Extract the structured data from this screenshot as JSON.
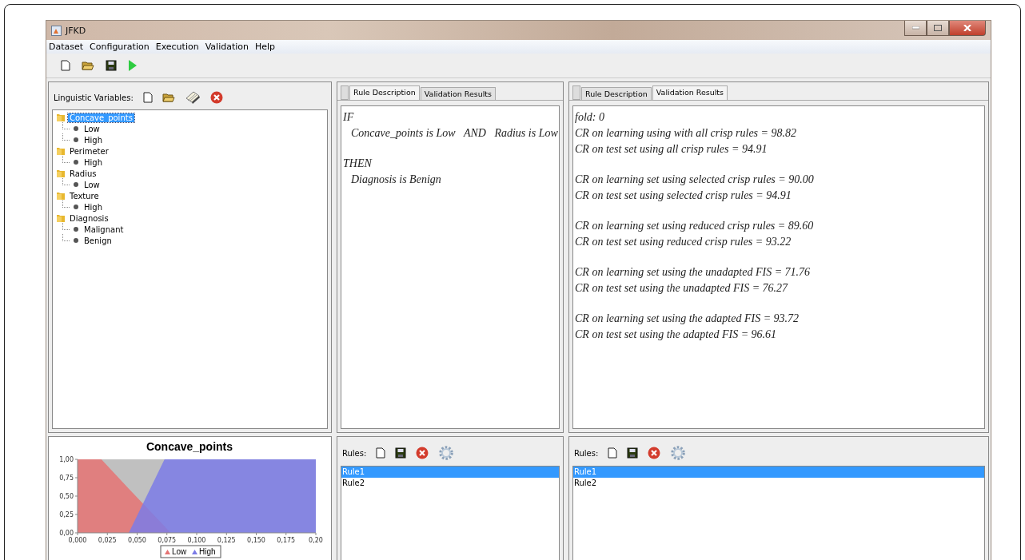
{
  "window": {
    "title": "JFKD"
  },
  "menu": [
    "Dataset",
    "Configuration",
    "Execution",
    "Validation",
    "Help"
  ],
  "variables": {
    "label": "Linguistic Variables:",
    "tree": [
      {
        "label": "Concave_points",
        "selected": true,
        "children": [
          {
            "label": "Low",
            "selected": false
          },
          {
            "label": "High",
            "selected": false
          }
        ]
      },
      {
        "label": "Perimeter",
        "selected": false,
        "children": [
          {
            "label": "High",
            "selected": false
          }
        ]
      },
      {
        "label": "Radius",
        "selected": false,
        "children": [
          {
            "label": "Low",
            "selected": false
          }
        ]
      },
      {
        "label": "Texture",
        "selected": false,
        "children": [
          {
            "label": "High",
            "selected": false
          }
        ]
      },
      {
        "label": "Diagnosis",
        "selected": false,
        "children": [
          {
            "label": "Malignant",
            "selected": false
          },
          {
            "label": "Benign",
            "selected": false
          }
        ]
      }
    ]
  },
  "membership_chart": {
    "chart_data": {
      "type": "area",
      "title": "Concave_points",
      "x": [
        0,
        0.02,
        0.043,
        0.073,
        0.078,
        0.2
      ],
      "series": [
        {
          "name": "Low",
          "color": "#e57373",
          "values": [
            1,
            1,
            0.6,
            0.09,
            0,
            null
          ]
        },
        {
          "name": "High",
          "color": "#7b7be6",
          "values": [
            null,
            null,
            0,
            1,
            1,
            1
          ]
        }
      ],
      "legend": "bottom",
      "xlim": [
        0,
        0.2
      ],
      "ylim": [
        0,
        1
      ],
      "xticks": [
        {
          "value": 0,
          "label": "0,000"
        },
        {
          "value": 0.025,
          "label": "0,025"
        },
        {
          "value": 0.05,
          "label": "0,050"
        },
        {
          "value": 0.075,
          "label": "0,075"
        },
        {
          "value": 0.1,
          "label": "0,100"
        },
        {
          "value": 0.125,
          "label": "0,125"
        },
        {
          "value": 0.15,
          "label": "0,150"
        },
        {
          "value": 0.175,
          "label": "0,175"
        },
        {
          "value": 0.2,
          "label": "0,20"
        }
      ],
      "yticks": [
        {
          "value": 0,
          "label": "0,00"
        },
        {
          "value": 0.25,
          "label": "0,25"
        },
        {
          "value": 0.5,
          "label": "0,50"
        },
        {
          "value": 0.75,
          "label": "0,75"
        },
        {
          "value": 1,
          "label": "1,00"
        }
      ]
    }
  },
  "rule_panel": {
    "tabs": [
      {
        "label": "Rule Description",
        "selected": true
      },
      {
        "label": "Validation Results",
        "selected": false
      }
    ],
    "rule": {
      "if": "IF",
      "condition": "Concave_points is Low   AND   Radius is Low",
      "then": "THEN",
      "conclusion": "Diagnosis is Benign"
    },
    "rules_label": "Rules:",
    "rules": [
      {
        "label": "Rule1",
        "selected": true
      },
      {
        "label": "Rule2",
        "selected": false
      }
    ]
  },
  "results_panel": {
    "tabs": [
      {
        "label": "Rule Description",
        "selected": false
      },
      {
        "label": "Validation Results",
        "selected": true
      }
    ],
    "groups": [
      [
        "fold: 0",
        "CR on learning using with all crisp rules = 98.82",
        "CR on test set using all crisp rules = 94.91"
      ],
      [
        "CR on learning set using selected crisp rules = 90.00",
        "CR on test set using selected crisp rules = 94.91"
      ],
      [
        "CR on learning set using reduced crisp rules = 89.60",
        "CR on test set using reduced crisp rules = 93.22"
      ],
      [
        "CR on learning set using the unadapted FIS = 71.76",
        "CR on test set using the unadapted FIS = 76.27"
      ],
      [
        "CR on learning set using the adapted FIS = 93.72",
        "CR on test set using the adapted FIS = 96.61"
      ]
    ],
    "rules_label": "Rules:",
    "rules": [
      {
        "label": "Rule1",
        "selected": true
      },
      {
        "label": "Rule2",
        "selected": false
      }
    ]
  }
}
